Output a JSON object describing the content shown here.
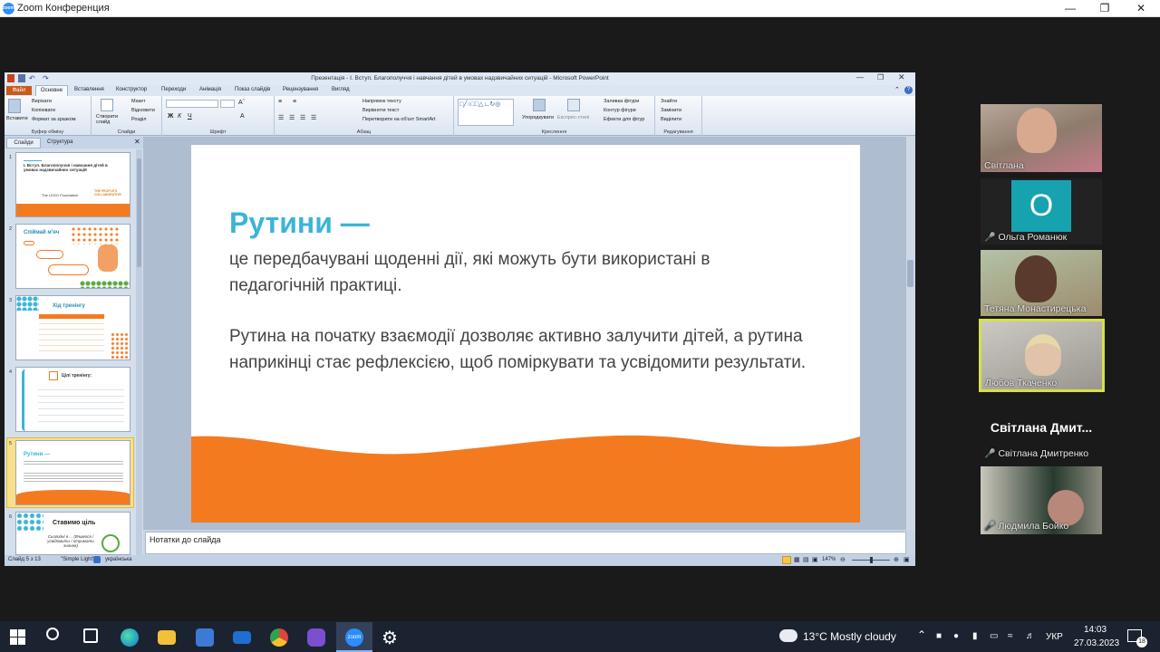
{
  "zoom": {
    "title": "Zoom Конференция",
    "logo_text": "zoom"
  },
  "ppt": {
    "title": "Презентація - І. Вступ. Благополуччя і навчання дітей в умовах надзвичайних ситуацій - Microsoft PowerPoint",
    "tabs": [
      "Файл",
      "Основне",
      "Вставлення",
      "Конструктор",
      "Переходи",
      "Анімація",
      "Показ слайдів",
      "Рецензування",
      "Вигляд"
    ],
    "ribbon": {
      "clipboard": {
        "paste": "Вставити",
        "cut": "Вирізати",
        "copy": "Копіювати",
        "format": "Формат за зразком",
        "label": "Буфер обміну"
      },
      "slides": {
        "new": "Створити слайд",
        "layout": "Макет",
        "reset": "Відновити",
        "section": "Розділ",
        "label": "Слайди"
      },
      "font": {
        "label": "Шрифт"
      },
      "paragraph": {
        "dir": "Напрямок тексту",
        "align": "Вирівняти текст",
        "smartart": "Перетворити на об'єкт SmartArt",
        "label": "Абзац"
      },
      "drawing": {
        "arrange": "Упорядкувати",
        "styles": "Експрес-стилі",
        "fill": "Заливка фігури",
        "outline": "Контур фігури",
        "effects": "Ефекти для фігур",
        "label": "Креслення"
      },
      "editing": {
        "find": "Знайти",
        "replace": "Замінити",
        "select": "Виділити",
        "label": "Редагування"
      }
    },
    "panel_tabs": [
      "Слайди",
      "Структура"
    ],
    "thumbs": [
      {
        "num": "1",
        "title": "І. Вступ. Благополуччя і навчання дітей в умовах надзвичайних ситуацій",
        "logo1": "The LEGO Foundation",
        "logo2": "THE PEOPLE'S COLLABORATIVE"
      },
      {
        "num": "2",
        "title": "Спіймай м'яч"
      },
      {
        "num": "3",
        "title": "Хід тренінгу"
      },
      {
        "num": "4",
        "title": "Цілі тренінгу:"
      },
      {
        "num": "5",
        "title": "Рутини —"
      },
      {
        "num": "6",
        "title": "Ставимо ціль",
        "sub": "Сьогодні я ... (Вчимося / усвідомити / отримати знання)"
      }
    ],
    "slide": {
      "heading": "Рутини —",
      "para1": "це передбачувані щоденні дії, які можуть бути використані в педагогічній практиці.",
      "para2": "Рутина на початку взаємодії дозволяє активно залучити дітей, а рутина наприкінці стає рефлексією, щоб поміркувати та усвідомити результати."
    },
    "notes_placeholder": "Нотатки до слайда",
    "status": {
      "slide": "Слайд 5 з 13",
      "theme": "\"Simple Light\"",
      "lang": "українська",
      "zoom": "147%"
    },
    "colors": {
      "accent_orange": "#f47a20",
      "heading_blue": "#3bb4d8"
    }
  },
  "participants": [
    {
      "name": "Світлана",
      "type": "video",
      "muted": false
    },
    {
      "name": "Ольга Романюк",
      "type": "avatar",
      "initial": "O",
      "muted": true
    },
    {
      "name": "Тетяна Монастирецька",
      "type": "video",
      "muted": false
    },
    {
      "name": "Любов Ткаченко",
      "type": "video",
      "muted": false,
      "active": true
    },
    {
      "name": "Світлана Дмитренко",
      "big_name": "Світлана Дмит...",
      "type": "name",
      "muted": true
    },
    {
      "name": "Людмила Бойко",
      "type": "video",
      "muted": true
    }
  ],
  "taskbar": {
    "weather": "13°C  Mostly cloudy",
    "lang": "УКР",
    "time": "14:03",
    "date": "27.03.2023",
    "notifications": "18",
    "zoom_label": "zoom"
  }
}
